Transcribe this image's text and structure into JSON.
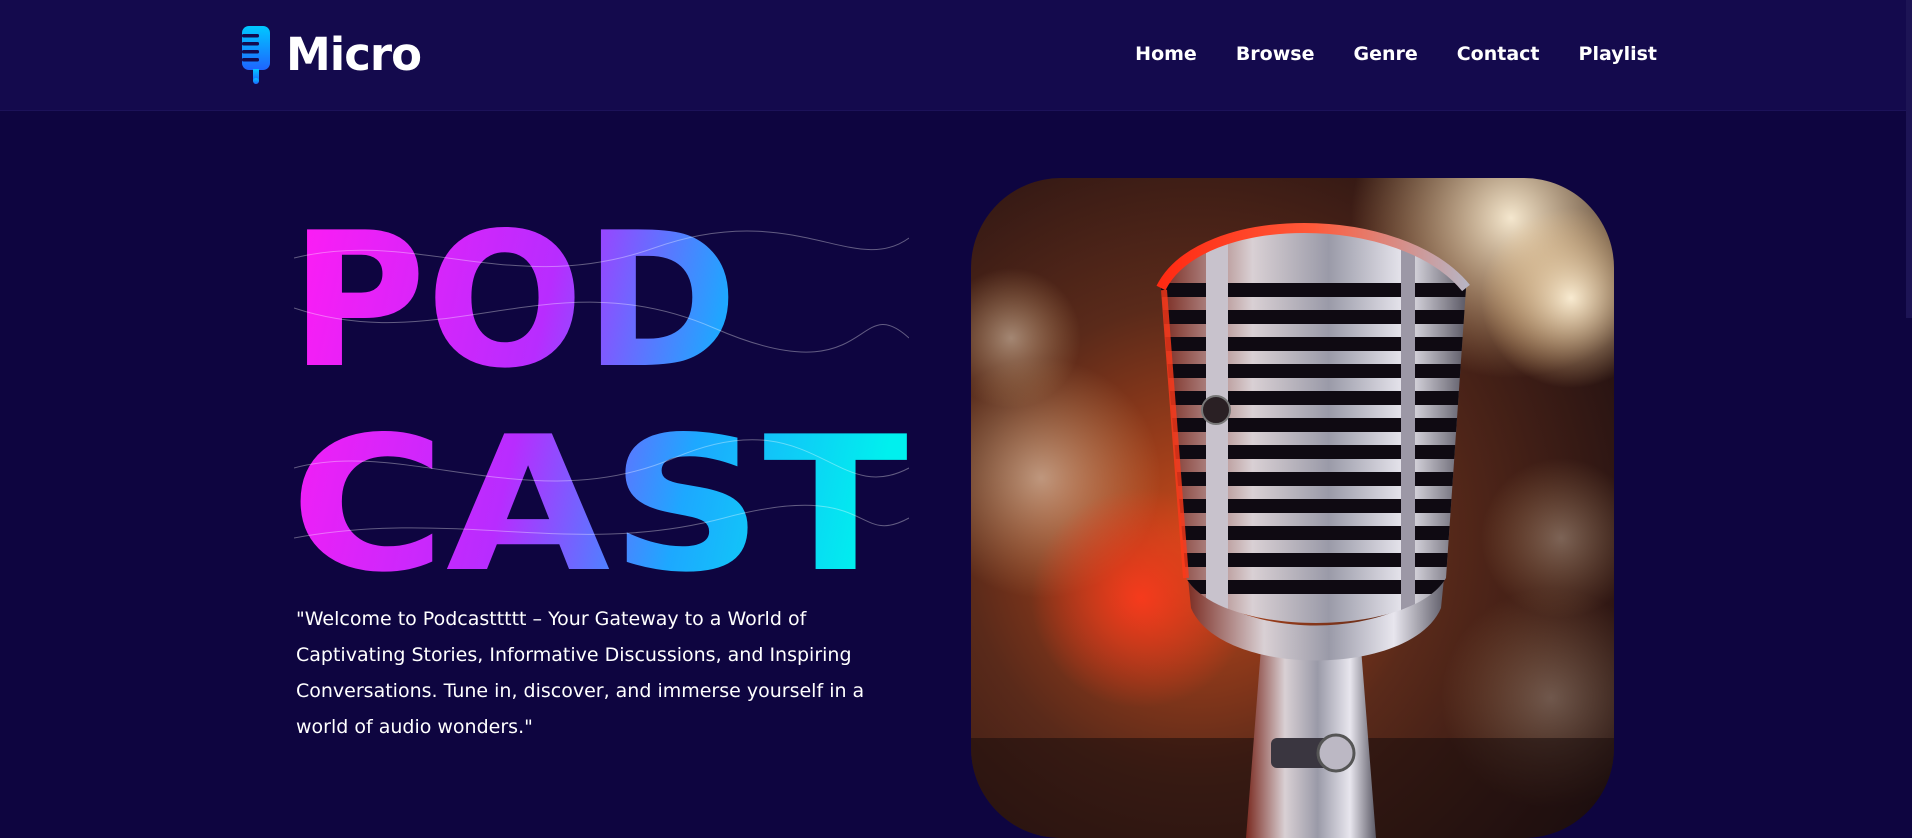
{
  "brand": {
    "name": "Micro",
    "icon": "microphone-icon",
    "gradient": [
      "#00c2ff",
      "#1e6dff"
    ]
  },
  "nav": {
    "items": [
      {
        "label": "Home"
      },
      {
        "label": "Browse"
      },
      {
        "label": "Genre"
      },
      {
        "label": "Contact"
      },
      {
        "label": "Playlist"
      }
    ]
  },
  "hero": {
    "title_line1": "POD",
    "title_line2": "CAST",
    "title_gradient": [
      "#ff1cf4",
      "#b82cff",
      "#1da8ff",
      "#00f0ee"
    ],
    "tagline": "\"Welcome to Podcasttttt – Your Gateway to a World of Captivating Stories, Informative Discussions, and Inspiring Conversations. Tune in, discover, and immerse yourself in a world of audio wonders.\"",
    "image": "vintage-microphone-photo"
  },
  "colors": {
    "background": "#0e0540",
    "navbar": "#140a4d",
    "text": "#ffffff"
  }
}
